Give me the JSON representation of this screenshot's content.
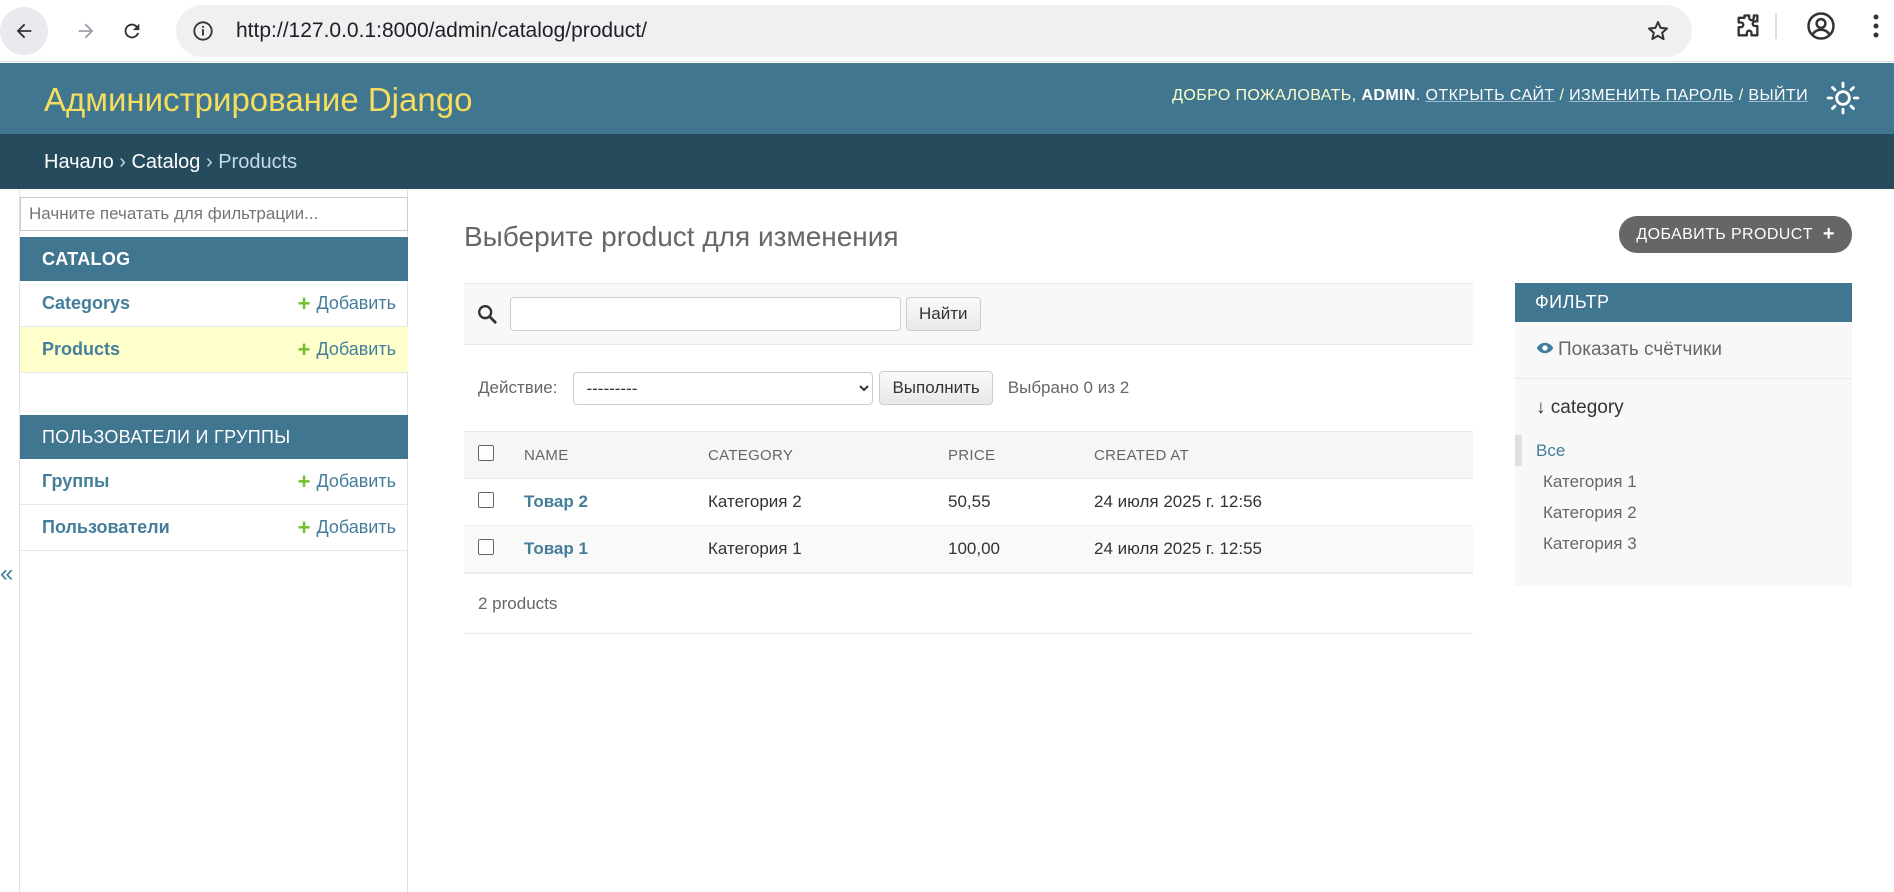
{
  "browser": {
    "url": "http://127.0.0.1:8000/admin/catalog/product/"
  },
  "header": {
    "brand": "Администрирование Django",
    "welcome": "Добро пожаловать,",
    "username": "admin",
    "open_site": "Открыть сайт",
    "change_password": "Изменить пароль",
    "logout": "Выйти"
  },
  "breadcrumbs": {
    "home": "Начало",
    "app": "Catalog",
    "current": "Products",
    "separator": "›"
  },
  "sidebar": {
    "filter_placeholder": "Начните печатать для фильтрации...",
    "modules": [
      {
        "caption": "Catalog",
        "items": [
          {
            "label": "Categorys",
            "add": "Добавить"
          },
          {
            "label": "Products",
            "add": "Добавить"
          }
        ]
      },
      {
        "caption": "Пользователи и группы",
        "items": [
          {
            "label": "Группы",
            "add": "Добавить"
          },
          {
            "label": "Пользователи",
            "add": "Добавить"
          }
        ]
      }
    ],
    "collapse_glyph": "«"
  },
  "main": {
    "title": "Выберите product для изменения",
    "add_button": "Добавить product",
    "search_button": "Найти",
    "action_label": "Действие:",
    "action_selected": "---------",
    "go_button": "Выполнить",
    "selection_counter": "Выбрано 0 из 2",
    "columns": [
      "Name",
      "Category",
      "Price",
      "Created at"
    ],
    "rows": [
      {
        "name": "Товар 2",
        "category": "Категория 2",
        "price": "50,55",
        "created_at": "24 июля 2025 г. 12:56"
      },
      {
        "name": "Товар 1",
        "category": "Категория 1",
        "price": "100,00",
        "created_at": "24 июля 2025 г. 12:55"
      }
    ],
    "paginator": "2 products"
  },
  "filter": {
    "caption": "Фильтр",
    "show_counts": "Показать счётчики",
    "heading": "↓ category",
    "options": [
      "Все",
      "Категория 1",
      "Категория 2",
      "Категория 3"
    ]
  },
  "colors": {
    "header": "#417690",
    "breadcrumbs": "#264b5d",
    "brand": "#f5dd5d",
    "link": "#447e9b",
    "add_plus": "#70bf2b",
    "active_row": "#ffffcc"
  }
}
